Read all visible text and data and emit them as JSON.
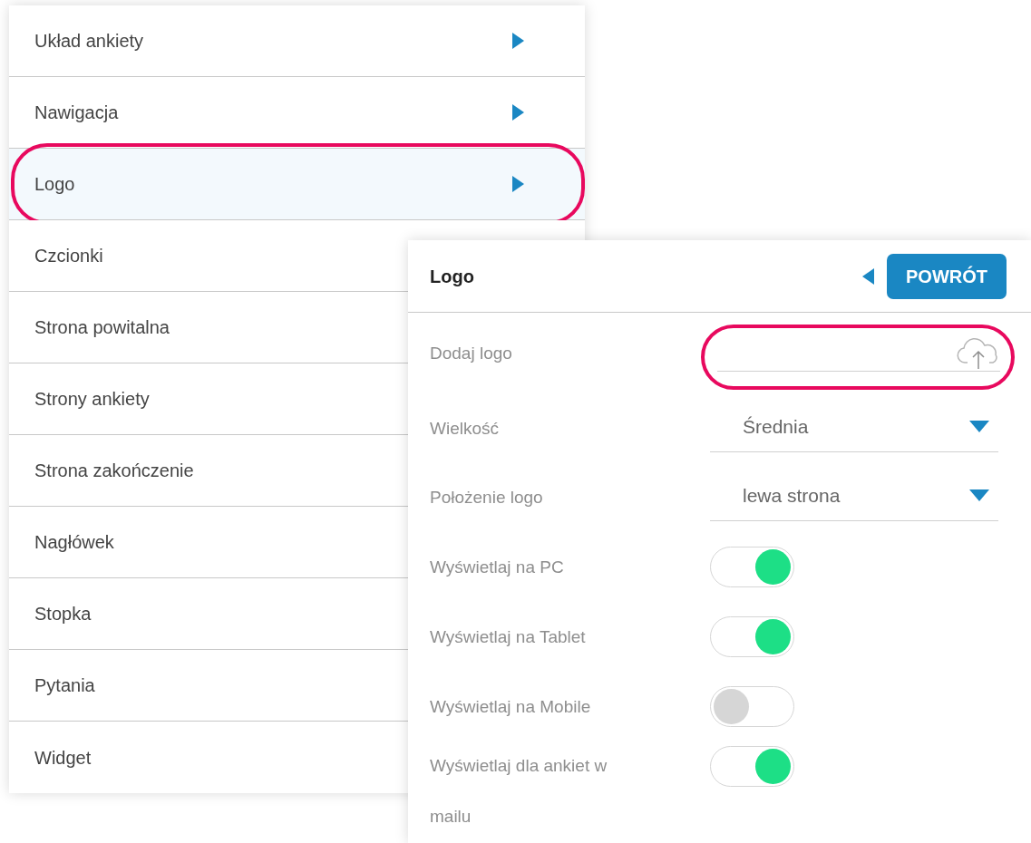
{
  "menu": {
    "items": [
      {
        "label": "Układ ankiety",
        "arrow": true,
        "selected": false,
        "highlighted": false
      },
      {
        "label": "Nawigacja",
        "arrow": true,
        "selected": false,
        "highlighted": false
      },
      {
        "label": "Logo",
        "arrow": true,
        "selected": true,
        "highlighted": true
      },
      {
        "label": "Czcionki",
        "arrow": false,
        "selected": false,
        "highlighted": false
      },
      {
        "label": "Strona powitalna",
        "arrow": false,
        "selected": false,
        "highlighted": false
      },
      {
        "label": "Strony ankiety",
        "arrow": false,
        "selected": false,
        "highlighted": false
      },
      {
        "label": "Strona zakończenie",
        "arrow": false,
        "selected": false,
        "highlighted": false
      },
      {
        "label": "Nagłówek",
        "arrow": false,
        "selected": false,
        "highlighted": false
      },
      {
        "label": "Stopka",
        "arrow": false,
        "selected": false,
        "highlighted": false
      },
      {
        "label": "Pytania",
        "arrow": false,
        "selected": false,
        "highlighted": false
      },
      {
        "label": "Widget",
        "arrow": false,
        "selected": false,
        "highlighted": false
      }
    ]
  },
  "panel": {
    "title": "Logo",
    "back_button": "POWRÓT",
    "rows": [
      {
        "kind": "upload",
        "label": "Dodaj logo",
        "highlighted": true
      },
      {
        "kind": "select",
        "label": "Wielkość",
        "value": "Średnia"
      },
      {
        "kind": "select",
        "label": "Położenie logo",
        "value": "lewa strona"
      },
      {
        "kind": "toggle",
        "label": "Wyświetlaj na PC",
        "on": true
      },
      {
        "kind": "toggle",
        "label": "Wyświetlaj na Tablet",
        "on": true
      },
      {
        "kind": "toggle",
        "label": "Wyświetlaj na Mobile",
        "on": false
      },
      {
        "kind": "toggle",
        "label": "Wyświetlaj dla ankiet w mailu",
        "on": true
      }
    ]
  }
}
